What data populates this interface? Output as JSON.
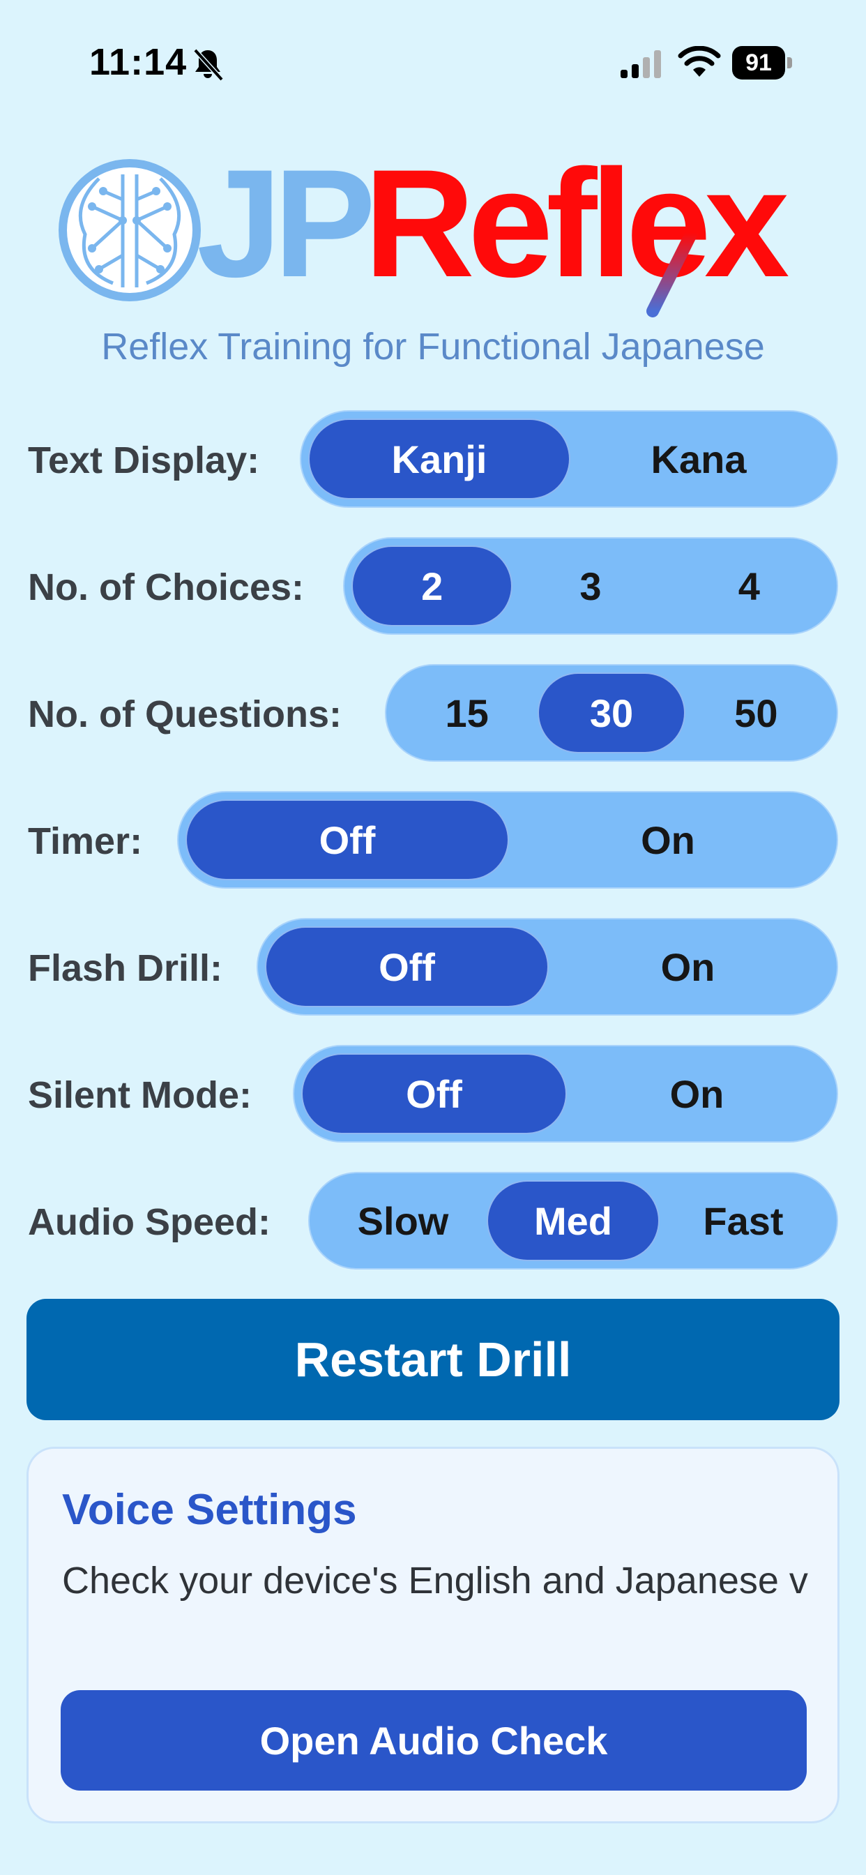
{
  "status_bar": {
    "time": "11:14",
    "battery": "91"
  },
  "logo": {
    "jp": "JP",
    "reflex": "Reflex",
    "tagline": "Reflex Training for Functional Japanese"
  },
  "settings": {
    "text_display": {
      "label": "Text Display:",
      "options": [
        "Kanji",
        "Kana"
      ],
      "selected": "Kanji"
    },
    "choices": {
      "label": "No. of Choices:",
      "options": [
        "2",
        "3",
        "4"
      ],
      "selected": "2"
    },
    "questions": {
      "label": "No. of Questions:",
      "options": [
        "15",
        "30",
        "50"
      ],
      "selected": "30"
    },
    "timer": {
      "label": "Timer:",
      "options": [
        "Off",
        "On"
      ],
      "selected": "Off"
    },
    "flash_drill": {
      "label": "Flash Drill:",
      "options": [
        "Off",
        "On"
      ],
      "selected": "Off"
    },
    "silent_mode": {
      "label": "Silent Mode:",
      "options": [
        "Off",
        "On"
      ],
      "selected": "Off"
    },
    "audio_speed": {
      "label": "Audio Speed:",
      "options": [
        "Slow",
        "Med",
        "Fast"
      ],
      "selected": "Med"
    }
  },
  "restart_label": "Restart Drill",
  "voice": {
    "title": "Voice Settings",
    "description": "Check your device's English and Japanese v",
    "button": "Open Audio Check"
  },
  "colors": {
    "background": "#dcf4fd",
    "segment": "#7cbcf9",
    "segment_active": "#2a56c9",
    "restart_button": "#0068b0",
    "logo_jp": "#7ab6ee",
    "logo_reflex": "#ff0a0a"
  },
  "icons": [
    "bell-slash-icon",
    "cellular-signal-icon",
    "wifi-icon",
    "battery-icon",
    "brain-icon"
  ]
}
